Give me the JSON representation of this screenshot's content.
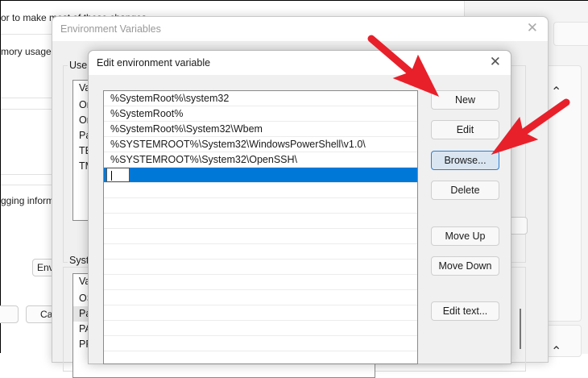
{
  "background_window": {
    "text_lines": [
      "or to make most of these changes",
      "mory usage, a",
      "gging informa"
    ],
    "buttons": [
      "Env",
      "Ca",
      ""
    ]
  },
  "env_dialog": {
    "title": "Environment Variables",
    "user_group_label": "User",
    "user_list": [
      "Va",
      "Or",
      "Or",
      "Pa",
      "TE",
      "TM"
    ],
    "system_group_label": "Syste",
    "system_list": [
      "Va",
      "OS",
      "Pa",
      "PA",
      "PR"
    ]
  },
  "edit_dialog": {
    "title": "Edit environment variable",
    "paths": [
      "%SystemRoot%\\system32",
      "%SystemRoot%",
      "%SystemRoot%\\System32\\Wbem",
      "%SYSTEMROOT%\\System32\\WindowsPowerShell\\v1.0\\",
      "%SYSTEMROOT%\\System32\\OpenSSH\\"
    ],
    "new_entry_value": "",
    "buttons": {
      "new": "New",
      "edit": "Edit",
      "browse": "Browse...",
      "delete": "Delete",
      "move_up": "Move Up",
      "move_down": "Move Down",
      "edit_text": "Edit text..."
    }
  },
  "colors": {
    "selection": "#0078d7",
    "arrow": "#e8202a",
    "focus_border": "#2e7ed1"
  }
}
